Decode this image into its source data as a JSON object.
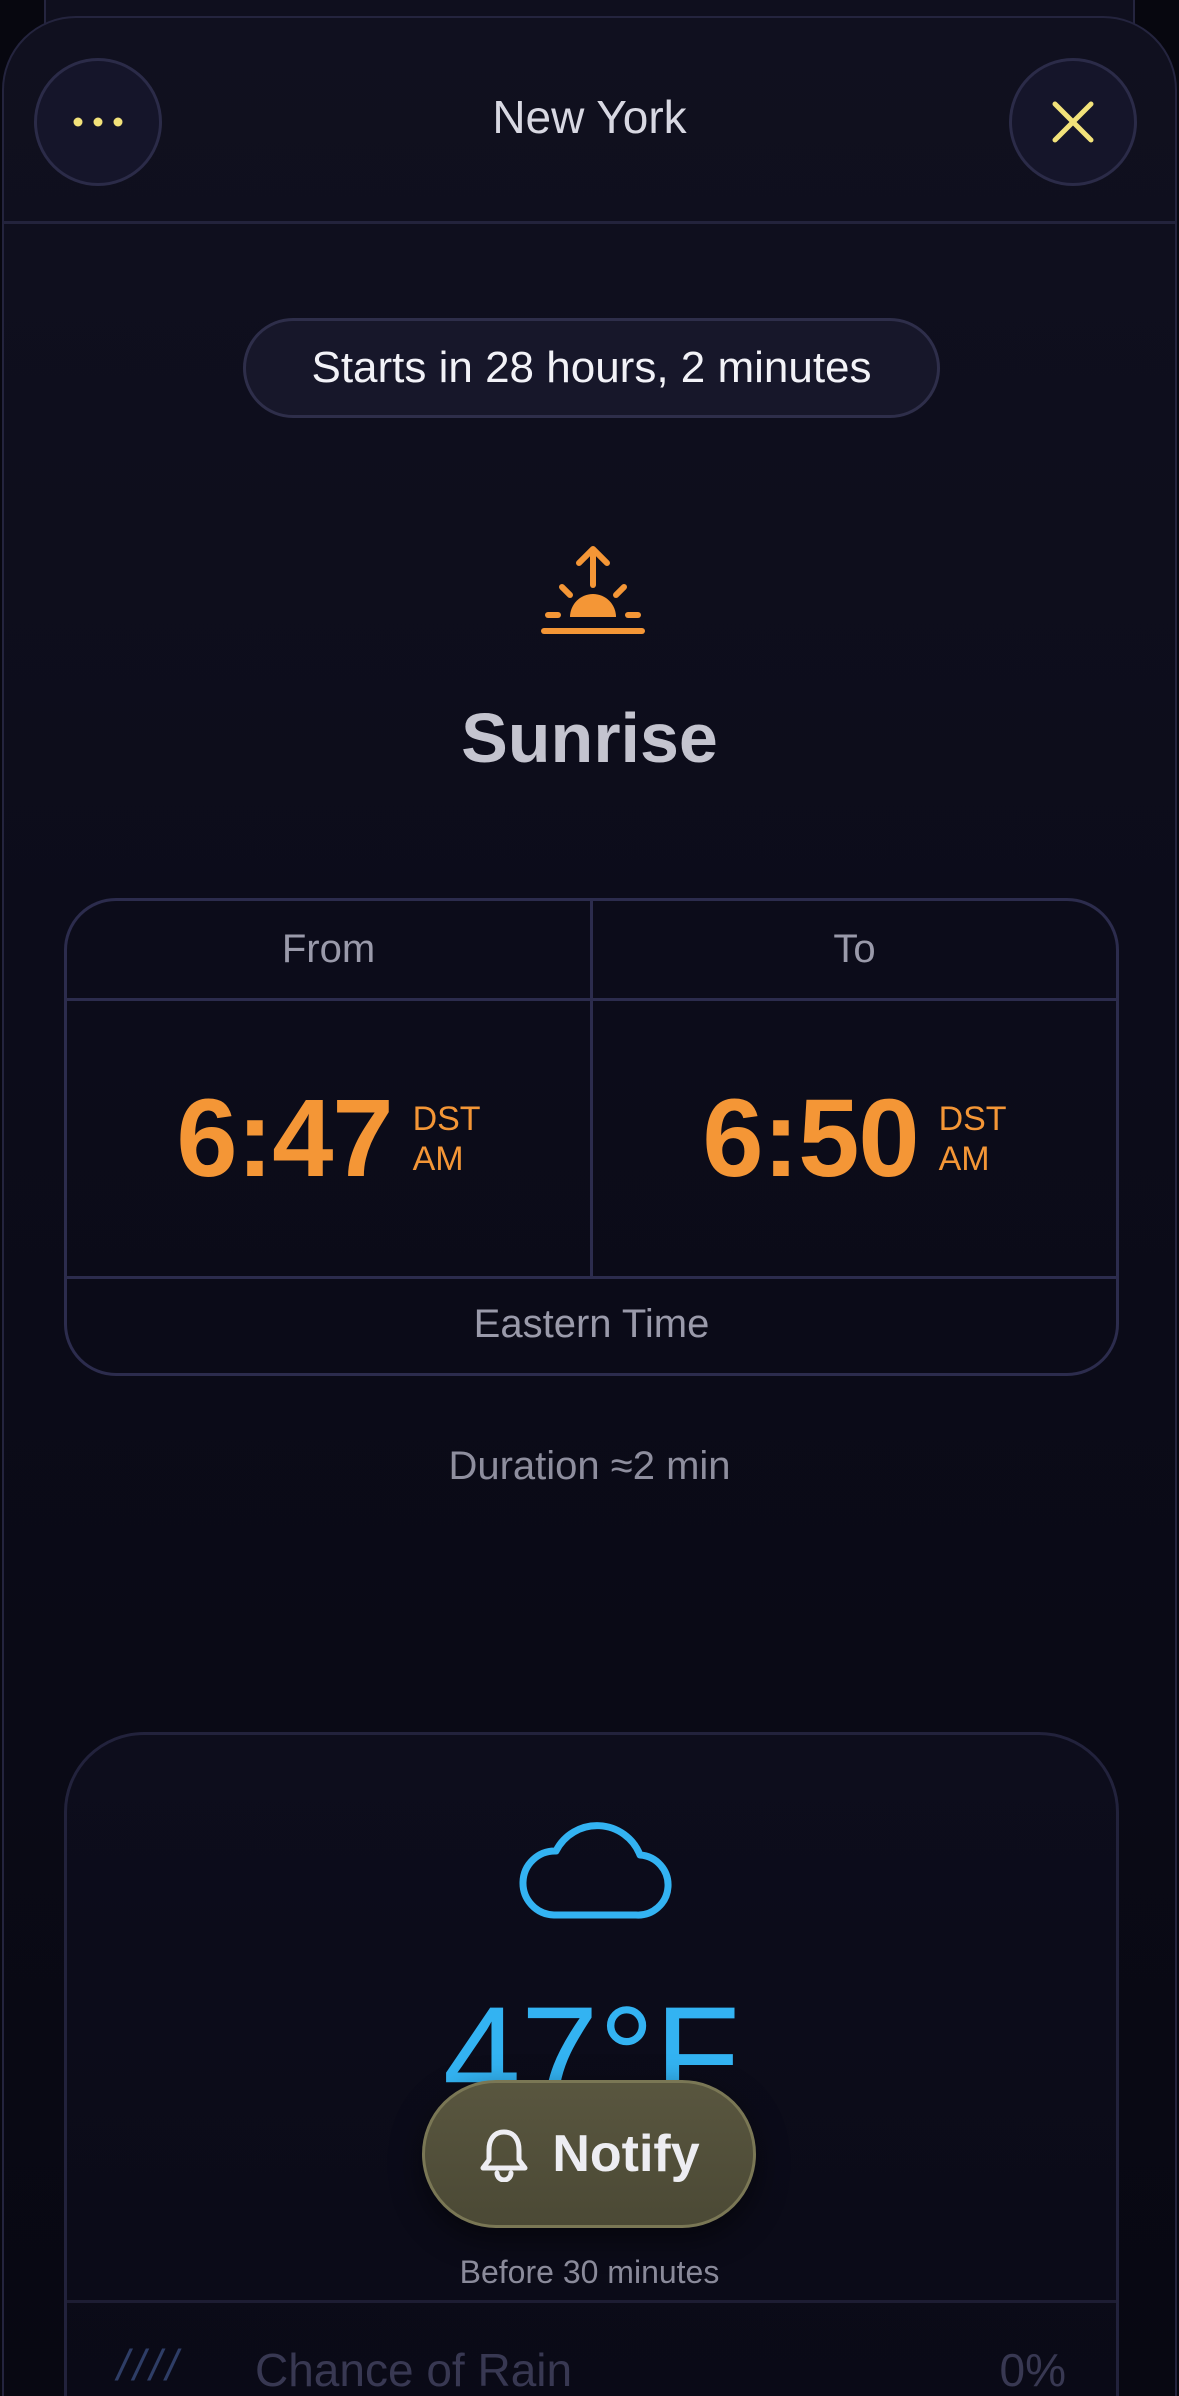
{
  "header": {
    "title": "New York",
    "menu_icon": "ellipsis-icon",
    "close_icon": "close-icon"
  },
  "countdown": "Starts in 28 hours, 2 minutes",
  "event": {
    "icon": "sunrise-icon",
    "title": "Sunrise"
  },
  "times": {
    "from_label": "From",
    "to_label": "To",
    "from": {
      "time": "6:47",
      "zone": "DST",
      "ampm": "AM"
    },
    "to": {
      "time": "6:50",
      "zone": "DST",
      "ampm": "AM"
    },
    "timezone": "Eastern Time"
  },
  "duration": "Duration ≈2 min",
  "weather": {
    "icon": "cloud-icon",
    "temperature": "47°F",
    "rain_label": "Chance of Rain",
    "rain_value": "0%"
  },
  "notify": {
    "label": "Notify",
    "subtitle": "Before 30 minutes"
  },
  "colors": {
    "accent_orange": "#f49636",
    "accent_blue": "#33b3f2",
    "close_yellow": "#f2e27a"
  }
}
